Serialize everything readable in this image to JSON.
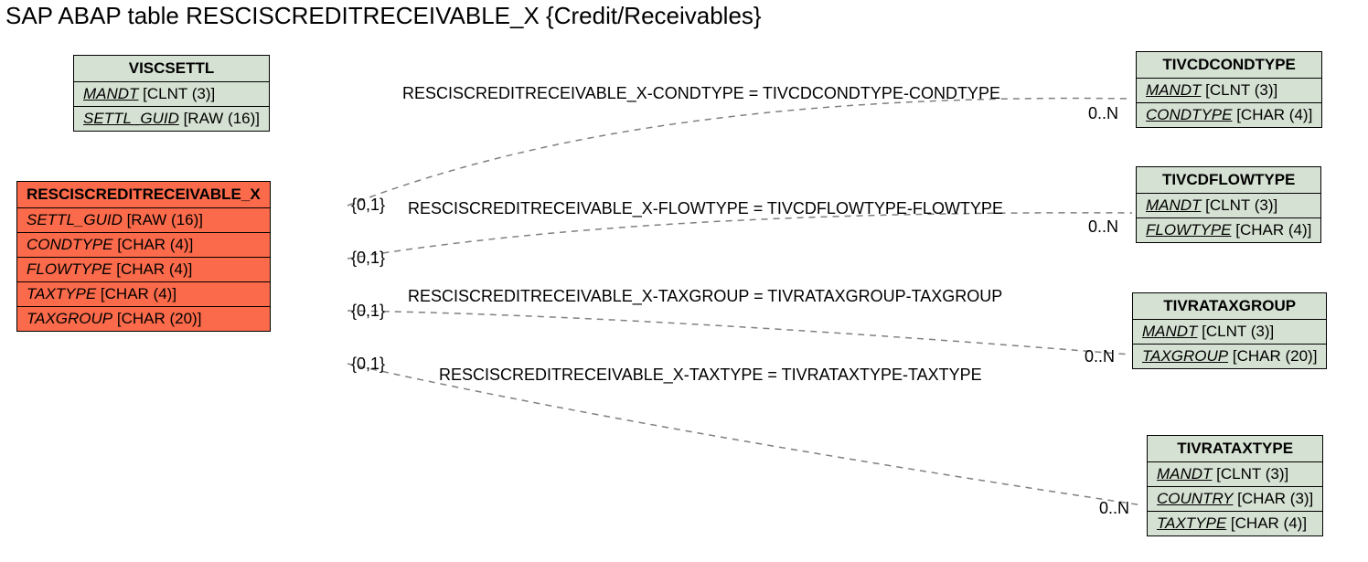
{
  "title": "SAP ABAP table RESCISCREDITRECEIVABLE_X {Credit/Receivables}",
  "entities": {
    "viscsettl": {
      "name": "VISCSETTL",
      "fields": [
        {
          "name": "MANDT",
          "type": "[CLNT (3)]",
          "underline": true
        },
        {
          "name": "SETTL_GUID",
          "type": "[RAW (16)]",
          "underline": true
        }
      ]
    },
    "main": {
      "name": "RESCISCREDITRECEIVABLE_X",
      "fields": [
        {
          "name": "SETTL_GUID",
          "type": "[RAW (16)]",
          "underline": false
        },
        {
          "name": "CONDTYPE",
          "type": "[CHAR (4)]",
          "underline": false
        },
        {
          "name": "FLOWTYPE",
          "type": "[CHAR (4)]",
          "underline": false
        },
        {
          "name": "TAXTYPE",
          "type": "[CHAR (4)]",
          "underline": false
        },
        {
          "name": "TAXGROUP",
          "type": "[CHAR (20)]",
          "underline": false
        }
      ]
    },
    "tivcdcondtype": {
      "name": "TIVCDCONDTYPE",
      "fields": [
        {
          "name": "MANDT",
          "type": "[CLNT (3)]",
          "underline": true
        },
        {
          "name": "CONDTYPE",
          "type": "[CHAR (4)]",
          "underline": true
        }
      ]
    },
    "tivcdflowtype": {
      "name": "TIVCDFLOWTYPE",
      "fields": [
        {
          "name": "MANDT",
          "type": "[CLNT (3)]",
          "underline": true
        },
        {
          "name": "FLOWTYPE",
          "type": "[CHAR (4)]",
          "underline": true
        }
      ]
    },
    "tivrataxgroup": {
      "name": "TIVRATAXGROUP",
      "fields": [
        {
          "name": "MANDT",
          "type": "[CLNT (3)]",
          "underline": true
        },
        {
          "name": "TAXGROUP",
          "type": "[CHAR (20)]",
          "underline": true
        }
      ]
    },
    "tivrataxtype": {
      "name": "TIVRATAXTYPE",
      "fields": [
        {
          "name": "MANDT",
          "type": "[CLNT (3)]",
          "underline": true
        },
        {
          "name": "COUNTRY",
          "type": "[CHAR (3)]",
          "underline": true
        },
        {
          "name": "TAXTYPE",
          "type": "[CHAR (4)]",
          "underline": true
        }
      ]
    }
  },
  "relations": {
    "r1": "RESCISCREDITRECEIVABLE_X-CONDTYPE = TIVCDCONDTYPE-CONDTYPE",
    "r2": "RESCISCREDITRECEIVABLE_X-FLOWTYPE = TIVCDFLOWTYPE-FLOWTYPE",
    "r3": "RESCISCREDITRECEIVABLE_X-TAXGROUP = TIVRATAXGROUP-TAXGROUP",
    "r4": "RESCISCREDITRECEIVABLE_X-TAXTYPE = TIVRATAXTYPE-TAXTYPE"
  },
  "card_left": "{0,1}",
  "card_right": "0..N"
}
